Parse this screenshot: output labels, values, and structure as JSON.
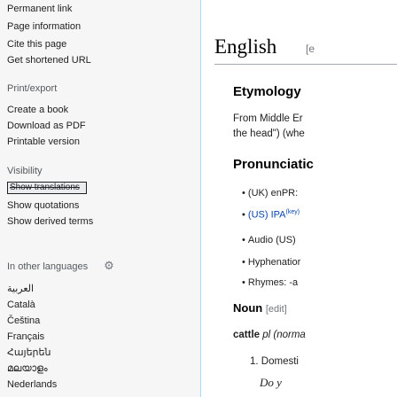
{
  "sidebar": {
    "tools": [
      "Permanent link",
      "Page information",
      "Cite this page",
      "Get shortened URL"
    ],
    "print_export": {
      "heading": "Print/export",
      "items": [
        "Create a book",
        "Download as PDF",
        "Printable version"
      ]
    },
    "visibility": {
      "heading": "Visibility",
      "button": "Show translations",
      "items": [
        "Show quotations",
        "Show derived terms"
      ]
    },
    "languages": {
      "heading": "In other languages",
      "items": [
        "العربية",
        "Català",
        "Čeština",
        "Français",
        "Հայերեն",
        "മലയാളം",
        "Nederlands"
      ]
    }
  },
  "content": {
    "language_heading": "English",
    "language_edit": "[e",
    "etymology_heading": "Etymology",
    "etymology_line1": "From Middle Er",
    "etymology_line2": "the head\") (whe",
    "pronunciation_heading": "Pronunciatic",
    "pronunciation_items": [
      {
        "label": "(UK) enPR:"
      },
      {
        "label": "(US) IPA",
        "sup": "(key)"
      },
      {
        "label": "Audio (US)"
      },
      {
        "label": "Hyphenatior"
      },
      {
        "label": "Rhymes: -a"
      }
    ],
    "noun_heading": "Noun",
    "noun_edit": "[edit]",
    "headword": "cattle",
    "headword_rest": "pl (norma",
    "definition": "1. Domesti",
    "definition_cont": "Do y"
  },
  "icons": {
    "settings": "gear-icon"
  }
}
